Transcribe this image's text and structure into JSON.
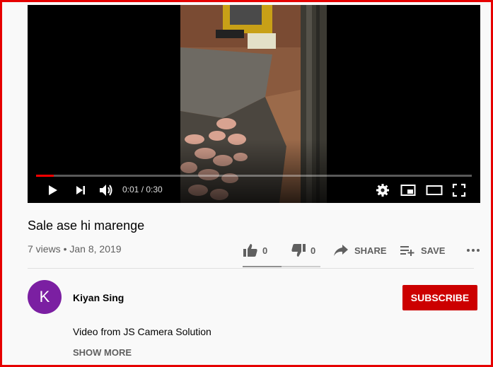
{
  "player": {
    "progress_fraction": 0.04,
    "time_current": "0:01",
    "time_separator": " / ",
    "time_total": "0:30",
    "progress_color": "#ff0000"
  },
  "video": {
    "title": "Sale ase hi marenge",
    "views": "7 views",
    "separator": " • ",
    "date": "Jan 8, 2019"
  },
  "actions": {
    "like_count": "0",
    "dislike_count": "0",
    "share_label": "SHARE",
    "save_label": "SAVE",
    "like_fraction": 0.5
  },
  "channel": {
    "avatar_letter": "K",
    "avatar_color": "#7b1fa2",
    "name": "Kiyan Sing",
    "subscribe_label": "SUBSCRIBE",
    "subscribe_color": "#cc0000"
  },
  "description": {
    "text": "Video from JS Camera Solution",
    "show_more_label": "SHOW MORE"
  },
  "icons": [
    "play-icon",
    "next-icon",
    "volume-icon",
    "settings-icon",
    "miniplayer-icon",
    "theater-icon",
    "fullscreen-icon",
    "like-icon",
    "dislike-icon",
    "share-icon",
    "add-to-playlist-icon",
    "more-icon"
  ]
}
